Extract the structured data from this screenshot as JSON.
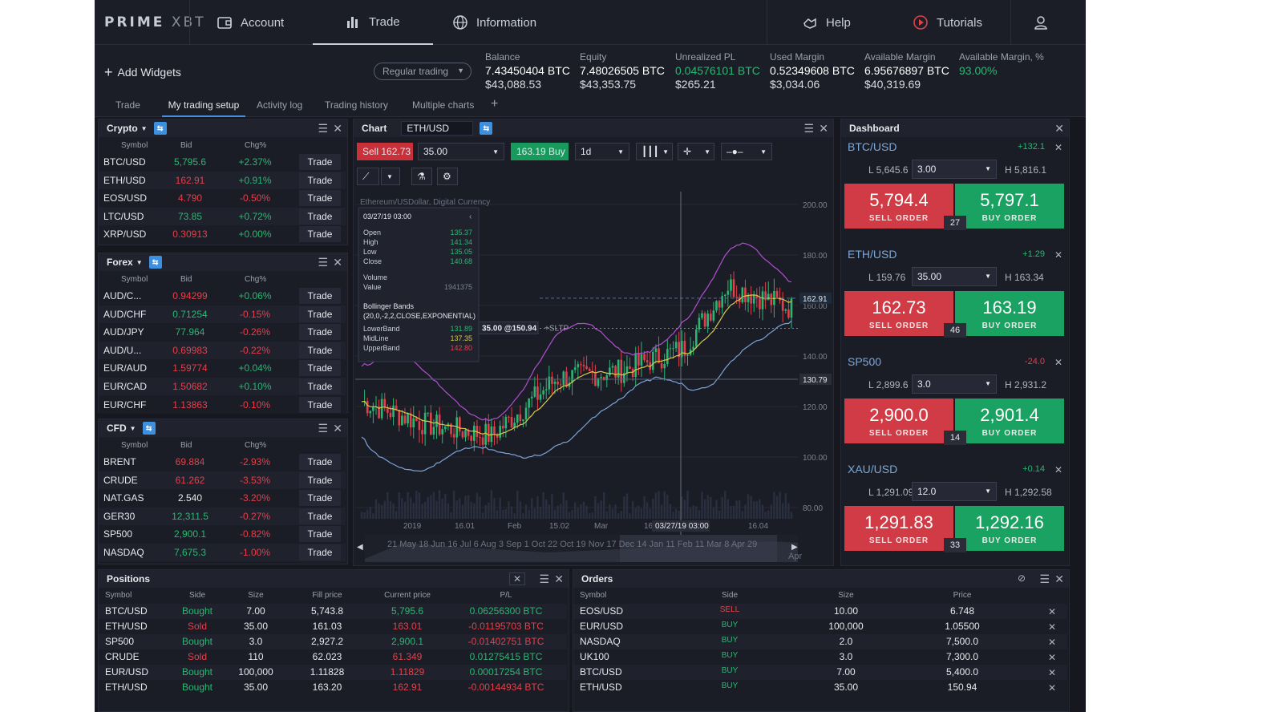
{
  "nav": {
    "logo_bold": "PRIME",
    "logo_light": "XBT",
    "account": "Account",
    "trade": "Trade",
    "information": "Information",
    "help": "Help",
    "tutorials": "Tutorials"
  },
  "infobar": {
    "add_widgets": "Add Widgets",
    "regular_trading": "Regular trading",
    "balance": {
      "label": "Balance",
      "btc": "7.43450404 BTC",
      "usd": "$43,088.53"
    },
    "equity": {
      "label": "Equity",
      "btc": "7.48026505 BTC",
      "usd": "$43,353.75"
    },
    "unrealized": {
      "label": "Unrealized PL",
      "btc": "0.04576101 BTC",
      "usd": "$265.21"
    },
    "used_margin": {
      "label": "Used Margin",
      "btc": "0.52349608 BTC",
      "usd": "$3,034.06"
    },
    "avail_margin": {
      "label": "Available Margin",
      "btc": "6.95676897 BTC",
      "usd": "$40,319.69"
    },
    "avail_margin_pct": {
      "label": "Available Margin, %",
      "value": "93.00%"
    }
  },
  "tabs": [
    "Trade",
    "My trading setup",
    "Activity log",
    "Trading history",
    "Multiple charts"
  ],
  "watch_cols": {
    "symbol": "Symbol",
    "bid": "Bid",
    "chg": "Chg%"
  },
  "trade_label": "Trade",
  "crypto": {
    "title": "Crypto",
    "rows": [
      {
        "symbol": "BTC/USD",
        "bid": "5,795.6",
        "chg": "+2.37%",
        "bid_dir": "up",
        "chg_dir": "up"
      },
      {
        "symbol": "ETH/USD",
        "bid": "162.91",
        "chg": "+0.91%",
        "bid_dir": "down",
        "chg_dir": "up"
      },
      {
        "symbol": "EOS/USD",
        "bid": "4.790",
        "chg": "-0.50%",
        "bid_dir": "down",
        "chg_dir": "down"
      },
      {
        "symbol": "LTC/USD",
        "bid": "73.85",
        "chg": "+0.72%",
        "bid_dir": "up",
        "chg_dir": "up"
      },
      {
        "symbol": "XRP/USD",
        "bid": "0.30913",
        "chg": "+0.00%",
        "bid_dir": "down",
        "chg_dir": "up"
      }
    ]
  },
  "forex": {
    "title": "Forex",
    "rows": [
      {
        "symbol": "AUD/C...",
        "bid": "0.94299",
        "chg": "+0.06%",
        "bid_dir": "down",
        "chg_dir": "up"
      },
      {
        "symbol": "AUD/CHF",
        "bid": "0.71254",
        "chg": "-0.15%",
        "bid_dir": "up",
        "chg_dir": "down"
      },
      {
        "symbol": "AUD/JPY",
        "bid": "77.964",
        "chg": "-0.26%",
        "bid_dir": "up",
        "chg_dir": "down"
      },
      {
        "symbol": "AUD/U...",
        "bid": "0.69983",
        "chg": "-0.22%",
        "bid_dir": "down",
        "chg_dir": "down"
      },
      {
        "symbol": "EUR/AUD",
        "bid": "1.59774",
        "chg": "+0.04%",
        "bid_dir": "down",
        "chg_dir": "up"
      },
      {
        "symbol": "EUR/CAD",
        "bid": "1.50682",
        "chg": "+0.10%",
        "bid_dir": "down",
        "chg_dir": "up"
      },
      {
        "symbol": "EUR/CHF",
        "bid": "1.13863",
        "chg": "-0.10%",
        "bid_dir": "down",
        "chg_dir": "down"
      }
    ]
  },
  "cfd": {
    "title": "CFD",
    "rows": [
      {
        "symbol": "BRENT",
        "bid": "69.884",
        "chg": "-2.93%",
        "bid_dir": "down",
        "chg_dir": "down"
      },
      {
        "symbol": "CRUDE",
        "bid": "61.262",
        "chg": "-3.53%",
        "bid_dir": "down",
        "chg_dir": "down"
      },
      {
        "symbol": "NAT.GAS",
        "bid": "2.540",
        "chg": "-3.20%",
        "bid_dir": "flat",
        "chg_dir": "down"
      },
      {
        "symbol": "GER30",
        "bid": "12,311.5",
        "chg": "-0.27%",
        "bid_dir": "up",
        "chg_dir": "down"
      },
      {
        "symbol": "SP500",
        "bid": "2,900.1",
        "chg": "-0.82%",
        "bid_dir": "up",
        "chg_dir": "down"
      },
      {
        "symbol": "NASDAQ",
        "bid": "7,675.3",
        "chg": "-1.00%",
        "bid_dir": "up",
        "chg_dir": "down"
      }
    ]
  },
  "chart": {
    "title": "Chart",
    "symbol": "ETH/USD",
    "sell_label": "Sell",
    "sell_price": "162.73",
    "qty": "35.00",
    "buy_price": "163.19",
    "buy_label": "Buy",
    "interval": "1d",
    "desc": "Ethereum/USDollar, Digital Currency",
    "tooltip": {
      "date": "03/27/19 03:00",
      "open_label": "Open",
      "open": "135.37",
      "high_label": "High",
      "high": "141.34",
      "low_label": "Low",
      "low": "135.05",
      "close_label": "Close",
      "close": "140.68",
      "volume_label": "Volume",
      "value_label": "Value",
      "value": "1941375",
      "bb_title": "Bollinger Bands",
      "bb_params": "(20,0,-2,2,CLOSE,EXPONENTIAL)",
      "lower_label": "LowerBand",
      "lower": "131.89",
      "mid_label": "MidLine",
      "mid": "137.35",
      "upper_label": "UpperBand",
      "upper": "142.80"
    },
    "order_tag": "35.00 @150.94",
    "sltp": "+SLTP",
    "price_labels": [
      "200.00",
      "180.00",
      "160.00",
      "140.00",
      "120.00",
      "100.00",
      "80.00"
    ],
    "current_price": "162.91",
    "order_price": "130.79",
    "x_labels": [
      "2019",
      "16.01",
      "Feb",
      "15.02",
      "Mar",
      "16.0",
      "16.04"
    ],
    "crosshair_date": "03/27/19 03:00",
    "nav_labels": "21 May 18 Jun  16 Jul 6 Aug   3 Sep   1 Oct 22 Oct  19 Nov 17 Dec 14 Jan  11 Feb  11 Mar 8 Apr 29",
    "nav_apr": "Apr"
  },
  "dashboard": {
    "title": "Dashboard",
    "sell_order": "SELL ORDER",
    "buy_order": "BUY ORDER",
    "instruments": [
      {
        "symbol": "BTC/USD",
        "chg": "+132.1",
        "dir": "up",
        "low": "L 5,645.6",
        "qty": "3.00",
        "high": "H 5,816.1",
        "sell": "5,794.4",
        "buy": "5,797.1",
        "spread": "27"
      },
      {
        "symbol": "ETH/USD",
        "chg": "+1.29",
        "dir": "up",
        "low": "L 159.76",
        "qty": "35.00",
        "high": "H 163.34",
        "sell": "162.73",
        "buy": "163.19",
        "spread": "46"
      },
      {
        "symbol": "SP500",
        "chg": "-24.0",
        "dir": "down",
        "low": "L 2,899.6",
        "qty": "3.0",
        "high": "H 2,931.2",
        "sell": "2,900.0",
        "buy": "2,901.4",
        "spread": "14"
      },
      {
        "symbol": "XAU/USD",
        "chg": "+0.14",
        "dir": "up",
        "low": "L 1,291.09",
        "qty": "12.0",
        "high": "H 1,292.58",
        "sell": "1,291.83",
        "buy": "1,292.16",
        "spread": "33"
      }
    ]
  },
  "positions": {
    "title": "Positions",
    "cols": [
      "Symbol",
      "Side",
      "Size",
      "Fill price",
      "Current price",
      "P/L"
    ],
    "rows": [
      {
        "symbol": "BTC/USD",
        "side": "Bought",
        "size": "7.00",
        "fill": "5,743.8",
        "current": "5,795.6",
        "pl": "0.06256300 BTC",
        "cur_dir": "up",
        "pl_dir": "up"
      },
      {
        "symbol": "ETH/USD",
        "side": "Sold",
        "size": "35.00",
        "fill": "161.03",
        "current": "163.01",
        "pl": "-0.01195703 BTC",
        "cur_dir": "down",
        "pl_dir": "down"
      },
      {
        "symbol": "SP500",
        "side": "Bought",
        "size": "3.0",
        "fill": "2,927.2",
        "current": "2,900.1",
        "pl": "-0.01402751 BTC",
        "cur_dir": "up",
        "pl_dir": "down"
      },
      {
        "symbol": "CRUDE",
        "side": "Sold",
        "size": "110",
        "fill": "62.023",
        "current": "61.349",
        "pl": "0.01275415 BTC",
        "cur_dir": "down",
        "pl_dir": "up"
      },
      {
        "symbol": "EUR/USD",
        "side": "Bought",
        "size": "100,000",
        "fill": "1.11828",
        "current": "1.11829",
        "pl": "0.00017254 BTC",
        "cur_dir": "down",
        "pl_dir": "up"
      },
      {
        "symbol": "ETH/USD",
        "side": "Bought",
        "size": "35.00",
        "fill": "163.20",
        "current": "162.91",
        "pl": "-0.00144934 BTC",
        "cur_dir": "down",
        "pl_dir": "down"
      }
    ]
  },
  "orders": {
    "title": "Orders",
    "cols": [
      "Symbol",
      "Side",
      "Size",
      "Price"
    ],
    "rows": [
      {
        "symbol": "EOS/USD",
        "side": "SELL",
        "size": "10.00",
        "price": "6.748"
      },
      {
        "symbol": "EUR/USD",
        "side": "BUY",
        "size": "100,000",
        "price": "1.05500"
      },
      {
        "symbol": "NASDAQ",
        "side": "BUY",
        "size": "2.0",
        "price": "7,500.0"
      },
      {
        "symbol": "UK100",
        "side": "BUY",
        "size": "3.0",
        "price": "7,300.0"
      },
      {
        "symbol": "BTC/USD",
        "side": "BUY",
        "size": "7.00",
        "price": "5,400.0"
      },
      {
        "symbol": "ETH/USD",
        "side": "BUY",
        "size": "35.00",
        "price": "150.94"
      }
    ]
  },
  "colors": {
    "up": "#2bb673",
    "down": "#e2404a",
    "accent": "#4a90e2",
    "upper_band": "#b04fd0",
    "mid_line": "#d8c84a",
    "lower_band": "#7aa4d8"
  }
}
